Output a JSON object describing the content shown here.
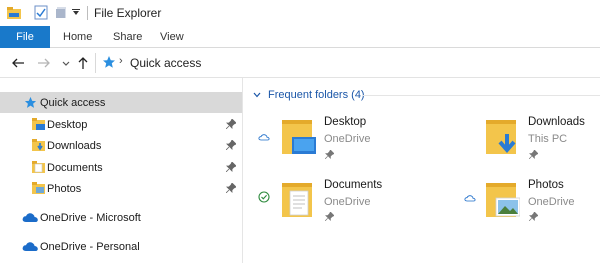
{
  "window": {
    "title": "File Explorer"
  },
  "ribbon": {
    "tabs": [
      {
        "label": "File"
      },
      {
        "label": "Home"
      },
      {
        "label": "Share"
      },
      {
        "label": "View"
      }
    ]
  },
  "address": {
    "path": "Quick access"
  },
  "nav": {
    "items": [
      {
        "label": "Quick access",
        "icon": "star-icon",
        "selected": true
      },
      {
        "label": "Desktop",
        "icon": "desktop-folder-icon",
        "pinned": true
      },
      {
        "label": "Downloads",
        "icon": "downloads-folder-icon",
        "pinned": true
      },
      {
        "label": "Documents",
        "icon": "documents-folder-icon",
        "pinned": true
      },
      {
        "label": "Photos",
        "icon": "photos-folder-icon",
        "pinned": true
      },
      {
        "label": "OneDrive - Microsoft",
        "icon": "onedrive-icon"
      },
      {
        "label": "OneDrive - Personal",
        "icon": "onedrive-icon"
      }
    ]
  },
  "content": {
    "group_title": "Frequent folders (4)",
    "folders": [
      {
        "name": "Desktop",
        "location": "OneDrive",
        "status": "cloud-icon",
        "pinned": true
      },
      {
        "name": "Downloads",
        "location": "This PC",
        "status": "",
        "pinned": true
      },
      {
        "name": "Documents",
        "location": "OneDrive",
        "status": "synced-check-icon",
        "pinned": true
      },
      {
        "name": "Photos",
        "location": "OneDrive",
        "status": "cloud-icon",
        "pinned": true
      }
    ]
  },
  "colors": {
    "accent": "#1979ca",
    "folder": "#f3c54b",
    "link": "#1a56a8",
    "selected": "#d9d9d9"
  }
}
